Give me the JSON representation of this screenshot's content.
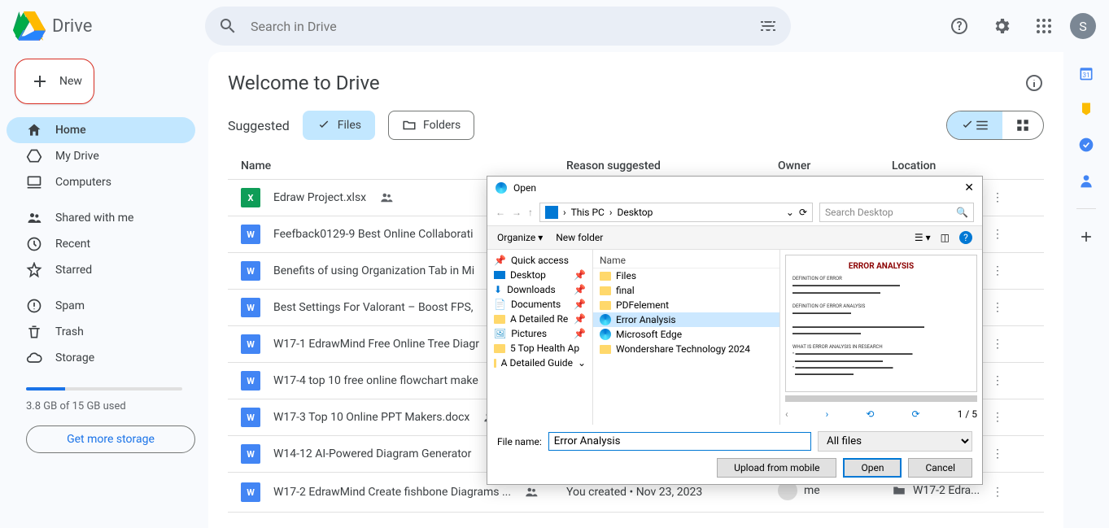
{
  "app": {
    "title": "Drive",
    "avatar_initial": "S"
  },
  "search": {
    "placeholder": "Search in Drive"
  },
  "sidebar": {
    "new_label": "New",
    "items": [
      {
        "label": "Home"
      },
      {
        "label": "My Drive"
      },
      {
        "label": "Computers"
      },
      {
        "label": "Shared with me"
      },
      {
        "label": "Recent"
      },
      {
        "label": "Starred"
      },
      {
        "label": "Spam"
      },
      {
        "label": "Trash"
      },
      {
        "label": "Storage"
      }
    ],
    "storage_text": "3.8 GB of 15 GB used",
    "storage_btn": "Get more storage"
  },
  "main": {
    "title": "Welcome to Drive",
    "suggested": "Suggested",
    "chip_files": "Files",
    "chip_folders": "Folders",
    "columns": {
      "name": "Name",
      "reason": "Reason suggested",
      "owner": "Owner",
      "location": "Location"
    }
  },
  "files": [
    {
      "name": "Edraw Project.xlsx",
      "type": "xlsx",
      "shared": true
    },
    {
      "name": "Feefback0129-9 Best Online Collaborati",
      "type": "docx"
    },
    {
      "name": "Benefits of using Organization Tab in Mi",
      "type": "docx"
    },
    {
      "name": "Best Settings For Valorant – Boost FPS,",
      "type": "docx"
    },
    {
      "name": "W17-1 EdrawMind Free Online Tree Diagr",
      "type": "docx"
    },
    {
      "name": "W17-4 top 10 free online flowchart make",
      "type": "docx"
    },
    {
      "name": "W17-3 Top 10 Online PPT Makers.docx",
      "type": "docx",
      "shared": true
    },
    {
      "name": "W14-12 AI-Powered Diagram Generator ",
      "type": "docx"
    },
    {
      "name": "W17-2 EdrawMind Create  fishbone Diagrams ...",
      "type": "docx",
      "shared": true,
      "reason": "You created • Nov 23, 2023",
      "owner": "me",
      "location": "W17-2 Edra..."
    }
  ],
  "dialog": {
    "title": "Open",
    "breadcrumb": {
      "root": "This PC",
      "folder": "Desktop"
    },
    "search_placeholder": "Search Desktop",
    "organize": "Organize",
    "new_folder": "New folder",
    "tree": {
      "quick_access": "Quick access",
      "desktop": "Desktop",
      "downloads": "Downloads",
      "documents": "Documents",
      "detailed": "A Detailed Re",
      "pictures": "Pictures",
      "top_health": "5 Top Health Ap",
      "detailed_guide": "A Detailed Guide"
    },
    "list_header": "Name",
    "list": [
      {
        "name": "Files",
        "icon": "folder"
      },
      {
        "name": "final",
        "icon": "folder"
      },
      {
        "name": "PDFelement",
        "icon": "folder"
      },
      {
        "name": "Error Analysis",
        "icon": "edge",
        "selected": true
      },
      {
        "name": "Microsoft Edge",
        "icon": "edge"
      },
      {
        "name": "Wondershare Technology 2024",
        "icon": "folder"
      }
    ],
    "preview_title": "ERROR ANALYSIS",
    "page_count": "1 / 5",
    "filename_label": "File name:",
    "filename_value": "Error Analysis",
    "filetype": "All files",
    "btn_upload_mobile": "Upload from mobile",
    "btn_open": "Open",
    "btn_cancel": "Cancel"
  }
}
